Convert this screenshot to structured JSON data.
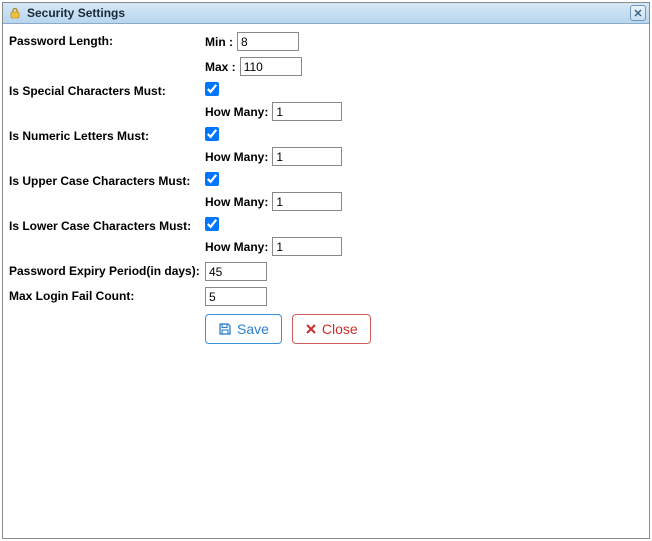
{
  "window": {
    "title": "Security Settings"
  },
  "fields": {
    "password_length": {
      "label": "Password Length:",
      "min_label": "Min :",
      "min_value": "8",
      "max_label": "Max :",
      "max_value": "110"
    },
    "special_chars": {
      "label": "Is Special Characters Must:",
      "checked": "true",
      "howmany_label": "How Many:",
      "howmany_value": "1"
    },
    "numeric": {
      "label": "Is Numeric Letters Must:",
      "checked": "true",
      "howmany_label": "How Many:",
      "howmany_value": "1"
    },
    "uppercase": {
      "label": "Is Upper Case Characters Must:",
      "checked": "true",
      "howmany_label": "How Many:",
      "howmany_value": "1"
    },
    "lowercase": {
      "label": "Is Lower Case Characters Must:",
      "checked": "true",
      "howmany_label": "How Many:",
      "howmany_value": "1"
    },
    "expiry": {
      "label": "Password Expiry Period(in days):",
      "value": "45"
    },
    "max_fail": {
      "label": "Max Login Fail Count:",
      "value": "5"
    }
  },
  "buttons": {
    "save": "Save",
    "close": "Close"
  }
}
